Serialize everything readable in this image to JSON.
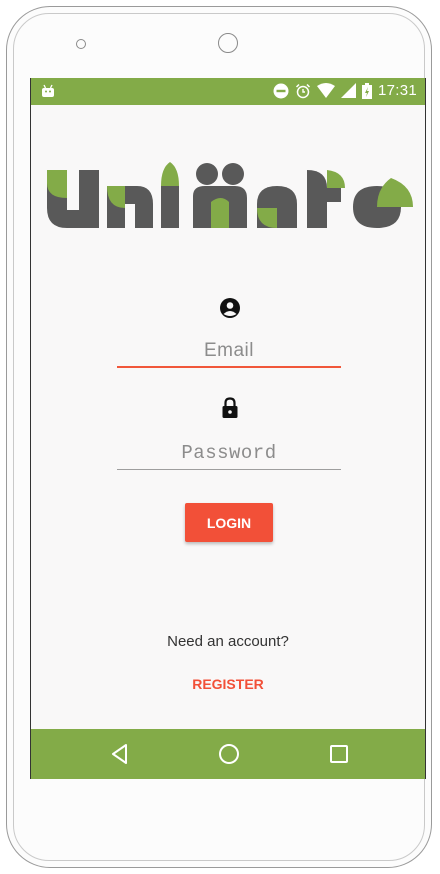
{
  "status_bar": {
    "time": "17:31",
    "icons": [
      "android-icon",
      "do-not-disturb-icon",
      "alarm-icon",
      "wifi-icon",
      "signal-icon",
      "battery-charging-icon"
    ]
  },
  "logo": {
    "text": "UniMate",
    "colors": {
      "dark": "#595959",
      "green": "#83ab48"
    }
  },
  "login_form": {
    "email_placeholder": "Email",
    "password_placeholder": "Password",
    "login_label": "LOGIN"
  },
  "footer": {
    "prompt": "Need an account?",
    "register_label": "REGISTER"
  },
  "nav": {
    "icons": [
      "back-icon",
      "home-icon",
      "recents-icon"
    ]
  },
  "colors": {
    "accent": "#f25038",
    "bar": "#83ab48",
    "background": "#f9f8f8"
  }
}
